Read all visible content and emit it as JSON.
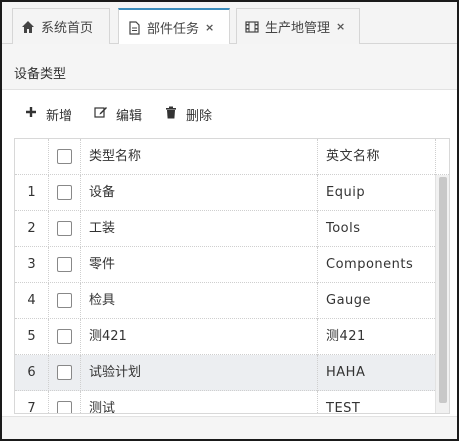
{
  "tabs": [
    {
      "label": "系统首页",
      "icon": "home-icon",
      "active": false,
      "closable": false
    },
    {
      "label": "部件任务",
      "icon": "document-icon",
      "active": true,
      "closable": true
    },
    {
      "label": "生产地管理",
      "icon": "film-icon",
      "active": false,
      "closable": true
    }
  ],
  "tab_close_glyph": "×",
  "panel": {
    "title": "设备类型"
  },
  "toolbar": {
    "add_label": "新增",
    "edit_label": "编辑",
    "delete_label": "删除"
  },
  "grid": {
    "columns": {
      "name": "类型名称",
      "english": "英文名称"
    },
    "rows": [
      {
        "num": "1",
        "name": "设备",
        "english": "Equip"
      },
      {
        "num": "2",
        "name": "工装",
        "english": "Tools"
      },
      {
        "num": "3",
        "name": "零件",
        "english": "Components"
      },
      {
        "num": "4",
        "name": "检具",
        "english": "Gauge"
      },
      {
        "num": "5",
        "name": "测421",
        "english": "测421"
      },
      {
        "num": "6",
        "name": "试验计划",
        "english": "HAHA"
      },
      {
        "num": "7",
        "name": "测试",
        "english": "TEST"
      }
    ],
    "highlighted_row": "6"
  }
}
